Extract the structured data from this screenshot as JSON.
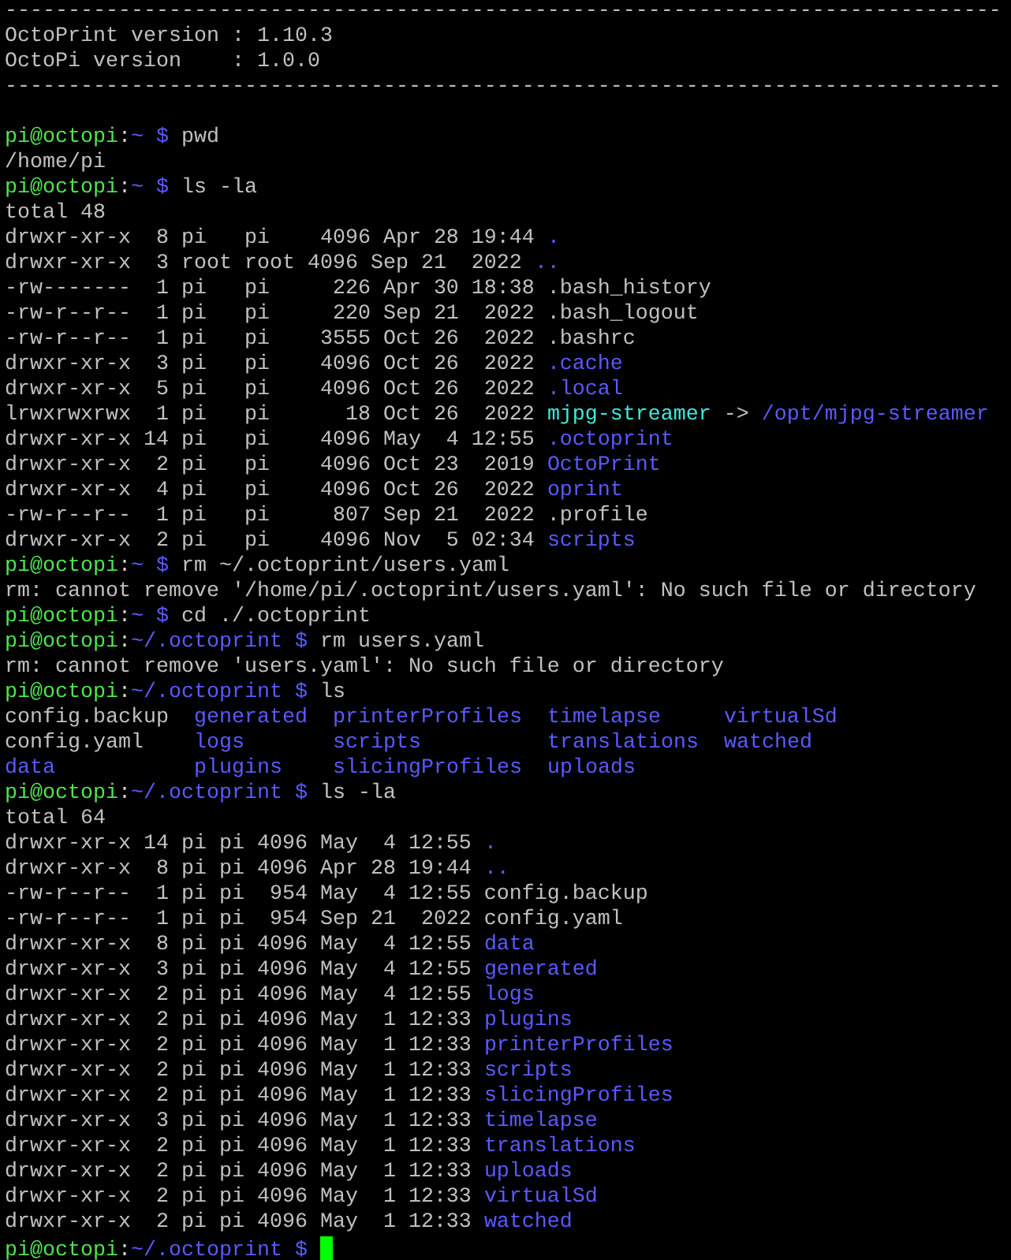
{
  "terminal": {
    "banner": [
      "-------------------------------------------------------------------------------",
      "OctoPrint version : 1.10.3",
      "OctoPi version    : 1.0.0",
      "-------------------------------------------------------------------------------"
    ],
    "session": [
      {
        "segments": [
          {
            "kind": "user",
            "text": "pi@octopi"
          },
          {
            "kind": "sep",
            "text": ":"
          },
          {
            "kind": "path",
            "text": "~ $ "
          },
          {
            "kind": "text",
            "text": "pwd"
          }
        ]
      },
      {
        "segments": [
          {
            "kind": "text",
            "text": "/home/pi"
          }
        ]
      },
      {
        "segments": [
          {
            "kind": "user",
            "text": "pi@octopi"
          },
          {
            "kind": "sep",
            "text": ":"
          },
          {
            "kind": "path",
            "text": "~ $ "
          },
          {
            "kind": "text",
            "text": "ls -la"
          }
        ]
      },
      {
        "segments": [
          {
            "kind": "text",
            "text": "total 48"
          }
        ]
      },
      {
        "segments": [
          {
            "kind": "text",
            "text": "drwxr-xr-x  8 pi   pi    4096 Apr 28 19:44 "
          },
          {
            "kind": "dir",
            "text": "."
          }
        ]
      },
      {
        "segments": [
          {
            "kind": "text",
            "text": "drwxr-xr-x  3 root root 4096 Sep 21  2022 "
          },
          {
            "kind": "dir",
            "text": ".."
          }
        ]
      },
      {
        "segments": [
          {
            "kind": "text",
            "text": "-rw-------  1 pi   pi     226 Apr 30 18:38 .bash_history"
          }
        ]
      },
      {
        "segments": [
          {
            "kind": "text",
            "text": "-rw-r--r--  1 pi   pi     220 Sep 21  2022 .bash_logout"
          }
        ]
      },
      {
        "segments": [
          {
            "kind": "text",
            "text": "-rw-r--r--  1 pi   pi    3555 Oct 26  2022 .bashrc"
          }
        ]
      },
      {
        "segments": [
          {
            "kind": "text",
            "text": "drwxr-xr-x  3 pi   pi    4096 Oct 26  2022 "
          },
          {
            "kind": "dir",
            "text": ".cache"
          }
        ]
      },
      {
        "segments": [
          {
            "kind": "text",
            "text": "drwxr-xr-x  5 pi   pi    4096 Oct 26  2022 "
          },
          {
            "kind": "dir",
            "text": ".local"
          }
        ]
      },
      {
        "segments": [
          {
            "kind": "text",
            "text": "lrwxrwxrwx  1 pi   pi      18 Oct 26  2022 "
          },
          {
            "kind": "link",
            "text": "mjpg-streamer "
          },
          {
            "kind": "text",
            "text": "-> "
          },
          {
            "kind": "dir",
            "text": "/opt/mjpg-streamer"
          }
        ]
      },
      {
        "segments": [
          {
            "kind": "text",
            "text": "drwxr-xr-x 14 pi   pi    4096 May  4 12:55 "
          },
          {
            "kind": "dir",
            "text": ".octoprint"
          }
        ]
      },
      {
        "segments": [
          {
            "kind": "text",
            "text": "drwxr-xr-x  2 pi   pi    4096 Oct 23  2019 "
          },
          {
            "kind": "dir",
            "text": "OctoPrint"
          }
        ]
      },
      {
        "segments": [
          {
            "kind": "text",
            "text": "drwxr-xr-x  4 pi   pi    4096 Oct 26  2022 "
          },
          {
            "kind": "dir",
            "text": "oprint"
          }
        ]
      },
      {
        "segments": [
          {
            "kind": "text",
            "text": "-rw-r--r--  1 pi   pi     807 Sep 21  2022 .profile"
          }
        ]
      },
      {
        "segments": [
          {
            "kind": "text",
            "text": "drwxr-xr-x  2 pi   pi    4096 Nov  5 02:34 "
          },
          {
            "kind": "dir",
            "text": "scripts"
          }
        ]
      },
      {
        "segments": [
          {
            "kind": "user",
            "text": "pi@octopi"
          },
          {
            "kind": "sep",
            "text": ":"
          },
          {
            "kind": "path",
            "text": "~ $ "
          },
          {
            "kind": "text",
            "text": "rm ~/.octoprint/users.yaml"
          }
        ]
      },
      {
        "segments": [
          {
            "kind": "text",
            "text": "rm: cannot remove '/home/pi/.octoprint/users.yaml': No such file or directory"
          }
        ]
      },
      {
        "segments": [
          {
            "kind": "user",
            "text": "pi@octopi"
          },
          {
            "kind": "sep",
            "text": ":"
          },
          {
            "kind": "path",
            "text": "~ $ "
          },
          {
            "kind": "text",
            "text": "cd ./.octoprint"
          }
        ]
      },
      {
        "segments": [
          {
            "kind": "user",
            "text": "pi@octopi"
          },
          {
            "kind": "sep",
            "text": ":"
          },
          {
            "kind": "path",
            "text": "~/.octoprint $ "
          },
          {
            "kind": "text",
            "text": "rm users.yaml"
          }
        ]
      },
      {
        "segments": [
          {
            "kind": "text",
            "text": "rm: cannot remove 'users.yaml': No such file or directory"
          }
        ]
      },
      {
        "segments": [
          {
            "kind": "user",
            "text": "pi@octopi"
          },
          {
            "kind": "sep",
            "text": ":"
          },
          {
            "kind": "path",
            "text": "~/.octoprint $ "
          },
          {
            "kind": "text",
            "text": "ls"
          }
        ]
      },
      {
        "segments": [
          {
            "kind": "text",
            "text": "config.backup  "
          },
          {
            "kind": "dir",
            "text": "generated  "
          },
          {
            "kind": "dir",
            "text": "printerProfiles  "
          },
          {
            "kind": "dir",
            "text": "timelapse     "
          },
          {
            "kind": "dir",
            "text": "virtualSd"
          }
        ]
      },
      {
        "segments": [
          {
            "kind": "text",
            "text": "config.yaml    "
          },
          {
            "kind": "dir",
            "text": "logs       "
          },
          {
            "kind": "dir",
            "text": "scripts          "
          },
          {
            "kind": "dir",
            "text": "translations  "
          },
          {
            "kind": "dir",
            "text": "watched"
          }
        ]
      },
      {
        "segments": [
          {
            "kind": "dir",
            "text": "data           "
          },
          {
            "kind": "dir",
            "text": "plugins    "
          },
          {
            "kind": "dir",
            "text": "slicingProfiles  "
          },
          {
            "kind": "dir",
            "text": "uploads"
          }
        ]
      },
      {
        "segments": [
          {
            "kind": "user",
            "text": "pi@octopi"
          },
          {
            "kind": "sep",
            "text": ":"
          },
          {
            "kind": "path",
            "text": "~/.octoprint $ "
          },
          {
            "kind": "text",
            "text": "ls -la"
          }
        ]
      },
      {
        "segments": [
          {
            "kind": "text",
            "text": "total 64"
          }
        ]
      },
      {
        "segments": [
          {
            "kind": "text",
            "text": "drwxr-xr-x 14 pi pi 4096 May  4 12:55 "
          },
          {
            "kind": "dir",
            "text": "."
          }
        ]
      },
      {
        "segments": [
          {
            "kind": "text",
            "text": "drwxr-xr-x  8 pi pi 4096 Apr 28 19:44 "
          },
          {
            "kind": "dir",
            "text": ".."
          }
        ]
      },
      {
        "segments": [
          {
            "kind": "text",
            "text": "-rw-r--r--  1 pi pi  954 May  4 12:55 config.backup"
          }
        ]
      },
      {
        "segments": [
          {
            "kind": "text",
            "text": "-rw-r--r--  1 pi pi  954 Sep 21  2022 config.yaml"
          }
        ]
      },
      {
        "segments": [
          {
            "kind": "text",
            "text": "drwxr-xr-x  8 pi pi 4096 May  4 12:55 "
          },
          {
            "kind": "dir",
            "text": "data"
          }
        ]
      },
      {
        "segments": [
          {
            "kind": "text",
            "text": "drwxr-xr-x  3 pi pi 4096 May  4 12:55 "
          },
          {
            "kind": "dir",
            "text": "generated"
          }
        ]
      },
      {
        "segments": [
          {
            "kind": "text",
            "text": "drwxr-xr-x  2 pi pi 4096 May  4 12:55 "
          },
          {
            "kind": "dir",
            "text": "logs"
          }
        ]
      },
      {
        "segments": [
          {
            "kind": "text",
            "text": "drwxr-xr-x  2 pi pi 4096 May  1 12:33 "
          },
          {
            "kind": "dir",
            "text": "plugins"
          }
        ]
      },
      {
        "segments": [
          {
            "kind": "text",
            "text": "drwxr-xr-x  2 pi pi 4096 May  1 12:33 "
          },
          {
            "kind": "dir",
            "text": "printerProfiles"
          }
        ]
      },
      {
        "segments": [
          {
            "kind": "text",
            "text": "drwxr-xr-x  2 pi pi 4096 May  1 12:33 "
          },
          {
            "kind": "dir",
            "text": "scripts"
          }
        ]
      },
      {
        "segments": [
          {
            "kind": "text",
            "text": "drwxr-xr-x  2 pi pi 4096 May  1 12:33 "
          },
          {
            "kind": "dir",
            "text": "slicingProfiles"
          }
        ]
      },
      {
        "segments": [
          {
            "kind": "text",
            "text": "drwxr-xr-x  3 pi pi 4096 May  1 12:33 "
          },
          {
            "kind": "dir",
            "text": "timelapse"
          }
        ]
      },
      {
        "segments": [
          {
            "kind": "text",
            "text": "drwxr-xr-x  2 pi pi 4096 May  1 12:33 "
          },
          {
            "kind": "dir",
            "text": "translations"
          }
        ]
      },
      {
        "segments": [
          {
            "kind": "text",
            "text": "drwxr-xr-x  2 pi pi 4096 May  1 12:33 "
          },
          {
            "kind": "dir",
            "text": "uploads"
          }
        ]
      },
      {
        "segments": [
          {
            "kind": "text",
            "text": "drwxr-xr-x  2 pi pi 4096 May  1 12:33 "
          },
          {
            "kind": "dir",
            "text": "virtualSd"
          }
        ]
      },
      {
        "segments": [
          {
            "kind": "text",
            "text": "drwxr-xr-x  2 pi pi 4096 May  1 12:33 "
          },
          {
            "kind": "dir",
            "text": "watched"
          }
        ]
      },
      {
        "segments": [
          {
            "kind": "user",
            "text": "pi@octopi"
          },
          {
            "kind": "sep",
            "text": ":"
          },
          {
            "kind": "path",
            "text": "~/.octoprint $ "
          }
        ]
      }
    ],
    "cursor_visible": true
  }
}
